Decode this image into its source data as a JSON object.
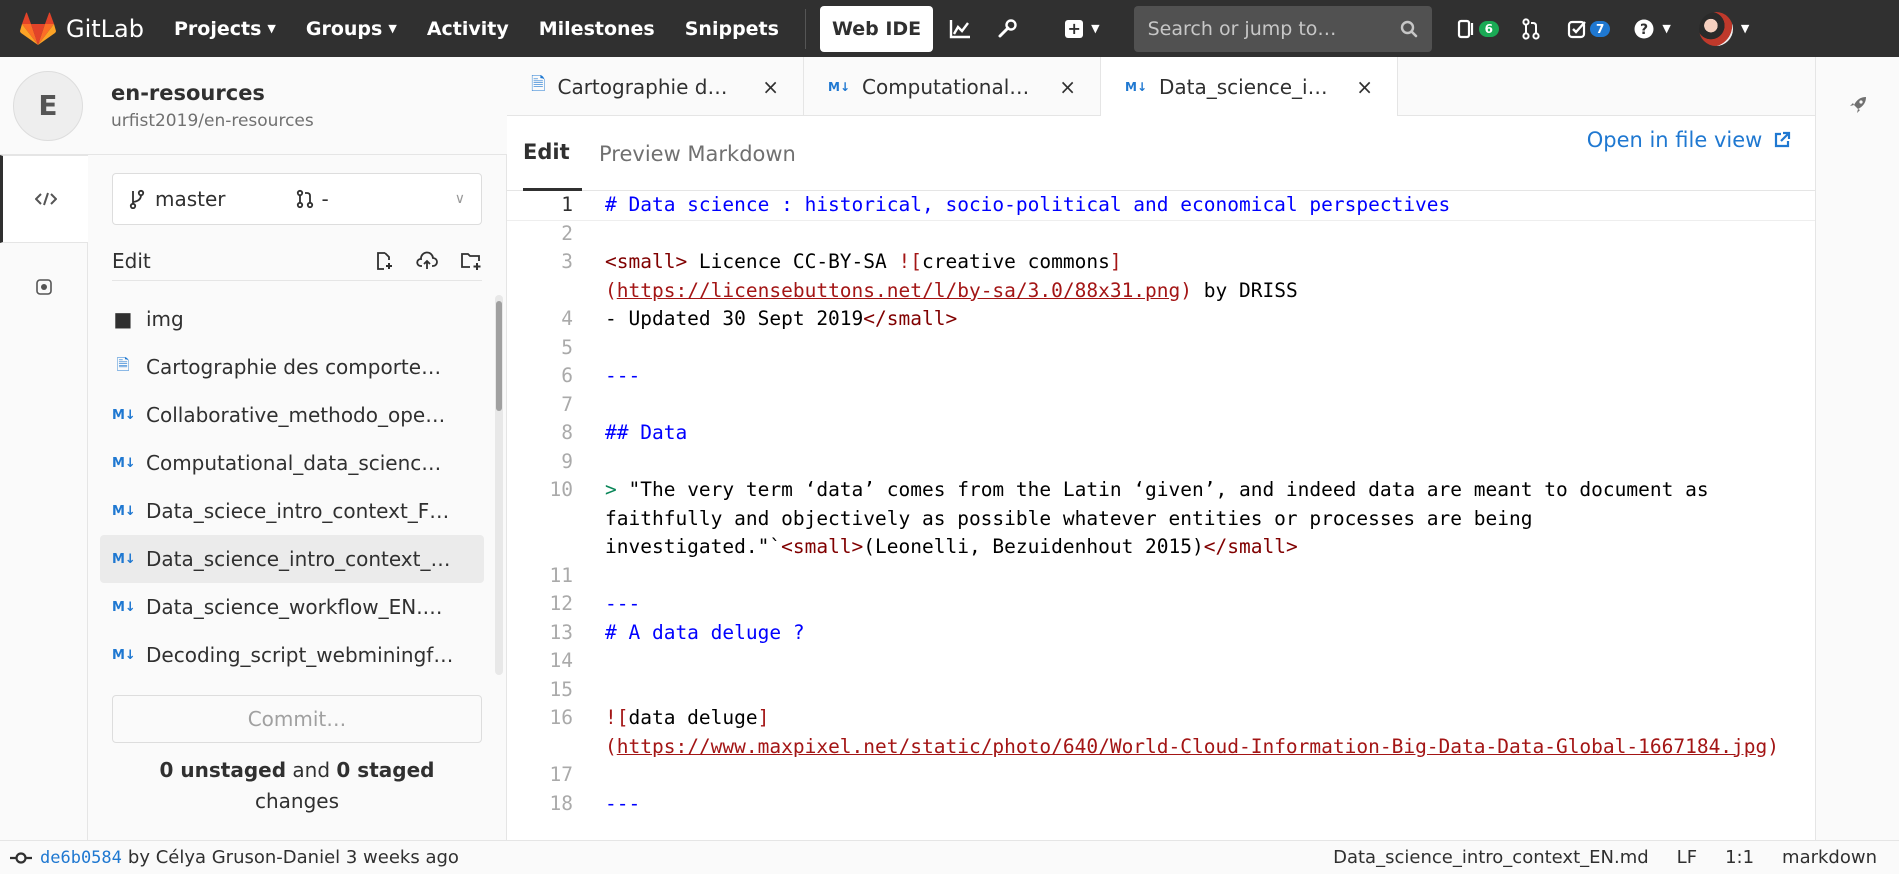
{
  "topbar": {
    "brand": "GitLab",
    "nav": [
      "Projects",
      "Groups",
      "Activity",
      "Milestones",
      "Snippets"
    ],
    "web_ide": "Web IDE",
    "search_placeholder": "Search or jump to…",
    "issues_count": "6",
    "todos_count": "7"
  },
  "project": {
    "avatar_letter": "E",
    "name": "en-resources",
    "path": "urfist2019/en-resources"
  },
  "sidebar": {
    "branch": "master",
    "merge_request": "-",
    "edit_label": "Edit",
    "files": [
      {
        "name": "img",
        "icon": "folder-icon"
      },
      {
        "name": "Cartographie des comporte…",
        "icon": "file-icon"
      },
      {
        "name": "Collaborative_methodo_ope…",
        "icon": "markdown-icon"
      },
      {
        "name": "Computational_data_scienc…",
        "icon": "markdown-icon"
      },
      {
        "name": "Data_sciece_intro_context_F…",
        "icon": "markdown-icon"
      },
      {
        "name": "Data_science_intro_context_…",
        "icon": "markdown-icon"
      },
      {
        "name": "Data_science_workflow_EN.…",
        "icon": "markdown-icon"
      },
      {
        "name": "Decoding_script_webminingf…",
        "icon": "markdown-icon"
      }
    ],
    "commit_button": "Commit…",
    "changes_unstaged": "0 unstaged",
    "changes_and": "and",
    "changes_staged": "0 staged",
    "changes_suffix": "changes"
  },
  "tabs": [
    {
      "name": "Cartographie d…",
      "icon": "file-icon"
    },
    {
      "name": "Computational…",
      "icon": "markdown-icon"
    },
    {
      "name": "Data_science_i…",
      "icon": "markdown-icon"
    }
  ],
  "editor": {
    "mode_edit": "Edit",
    "mode_preview": "Preview Markdown",
    "open_in_file_view": "Open in file view",
    "lines": {
      "l1": "# Data science : historical, socio-political and economical perspectives",
      "l3a": "<small>",
      "l3b": " Licence CC-BY-SA ",
      "l3c": "![",
      "l3d": "creative commons",
      "l3e": "]",
      "l3f": "(",
      "l3g": "https://licensebuttons.net/l/by-sa/3.0/88x31.png",
      "l3h": ")",
      "l3i": " by DRISS",
      "l4a": "- Updated 30 Sept 2019",
      "l4b": "</small>",
      "l6": "---",
      "l8": "## Data",
      "l10a": ">",
      "l10b": " \"The very term ‘data’ comes from the Latin ‘given’, and indeed data are meant to document as faithfully and objectively as possible whatever entities or processes are being investigated.\"`",
      "l10c": "<small>",
      "l10d": "(Leonelli, Bezuidenhout 2015)",
      "l10e": "</small>",
      "l12": "---",
      "l13": "# A data deluge ?",
      "l16a": "![",
      "l16b": "data deluge",
      "l16c": "]",
      "l16d": "(",
      "l16e": "https://www.maxpixel.net/static/photo/640/World-Cloud-Information-Big-Data-Data-Global-1667184.jpg",
      "l16f": ")",
      "l18": "---"
    },
    "line_numbers": [
      "1",
      "2",
      "3",
      "4",
      "5",
      "6",
      "7",
      "8",
      "9",
      "10",
      "11",
      "12",
      "13",
      "14",
      "15",
      "16",
      "17",
      "18"
    ]
  },
  "statusbar": {
    "commit_sha": "de6b0584",
    "commit_info": "by Célya Gruson-Daniel 3 weeks ago",
    "file_name": "Data_science_intro_context_EN.md",
    "eol": "LF",
    "position": "1:1",
    "language": "markdown"
  }
}
